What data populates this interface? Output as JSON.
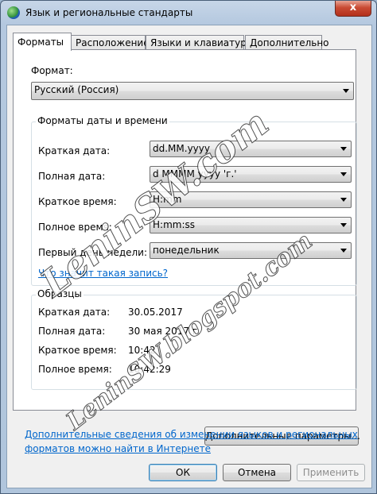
{
  "window": {
    "title": "Язык и региональные стандарты",
    "close_label": "x"
  },
  "tabs": [
    {
      "label": "Форматы",
      "active": true
    },
    {
      "label": "Расположение",
      "active": false
    },
    {
      "label": "Языки и клавиатуры",
      "active": false
    },
    {
      "label": "Дополнительно",
      "active": false
    }
  ],
  "format": {
    "label": "Формат:",
    "value": "Русский (Россия)"
  },
  "datetime": {
    "group_title": "Форматы даты и времени",
    "rows": [
      {
        "label": "Краткая дата:",
        "value": "dd.MM.yyyy"
      },
      {
        "label": "Полная дата:",
        "value": "d MMMM yyyy 'г.'"
      },
      {
        "label": "Краткое время:",
        "value": "H:mm"
      },
      {
        "label": "Полное время:",
        "value": "H:mm:ss"
      },
      {
        "label": "Первый день недели:",
        "value": "понедельник"
      }
    ],
    "help_link": "Что значит такая запись?"
  },
  "samples": {
    "group_title": "Образцы",
    "rows": [
      {
        "label": "Краткая дата:",
        "value": "30.05.2017"
      },
      {
        "label": "Полная дата:",
        "value": "30 мая 2017 г."
      },
      {
        "label": "Краткое время:",
        "value": "10:42"
      },
      {
        "label": "Полное время:",
        "value": "10:42:29"
      }
    ]
  },
  "additional_button": "Дополнительные параметры...",
  "info_link_line1": "Дополнительные сведения об изменении языков и региональных",
  "info_link_line2": "форматов можно найти в Интернете",
  "footer": {
    "ok": "ОК",
    "cancel": "Отмена",
    "apply": "Применить"
  },
  "watermarks": {
    "line1": "LeninSW.com",
    "line2": "LeninSW.blogspot.com"
  },
  "colors": {
    "link": "#0066cc",
    "close_button": "#c94b34"
  }
}
